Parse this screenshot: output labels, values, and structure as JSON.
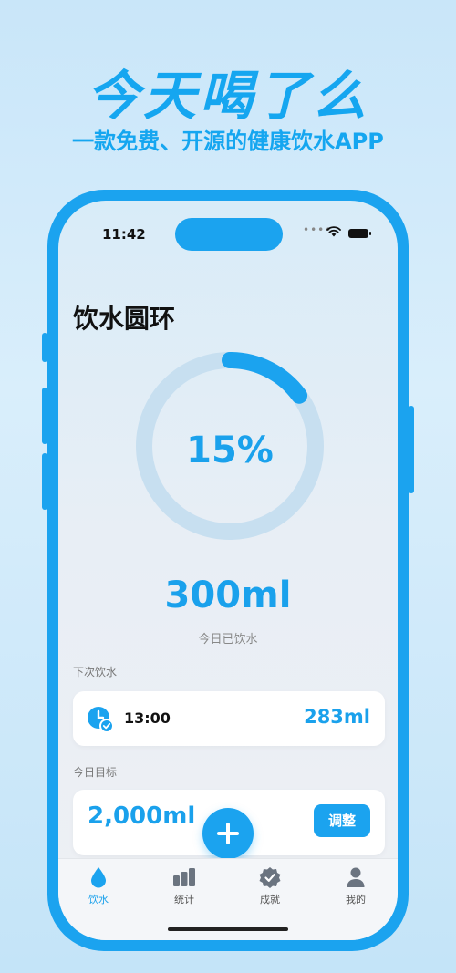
{
  "hero": {
    "title": "今天喝了么",
    "subtitle": "一款免费、开源的健康饮水APP"
  },
  "statusbar": {
    "time": "11:42",
    "signal_icon": "signal-dots-icon",
    "wifi_icon": "wifi-icon",
    "battery_icon": "battery-icon"
  },
  "page": {
    "title": "饮水圆环"
  },
  "progress": {
    "percent_text": "15%",
    "fraction": 0.15,
    "amount": "300ml",
    "amount_label": "今日已饮水"
  },
  "next_drink": {
    "section_label": "下次饮水",
    "time": "13:00",
    "amount": "283ml",
    "icon": "clock-check-icon"
  },
  "goal": {
    "section_label": "今日目标",
    "value": "2,000ml",
    "adjust_label": "调整"
  },
  "fab": {
    "icon": "plus-icon"
  },
  "tabs": [
    {
      "label": "饮水",
      "icon": "water-drop-icon",
      "active": true
    },
    {
      "label": "统计",
      "icon": "bar-chart-icon",
      "active": false
    },
    {
      "label": "成就",
      "icon": "badge-check-icon",
      "active": false
    },
    {
      "label": "我的",
      "icon": "user-icon",
      "active": false
    }
  ],
  "colors": {
    "accent": "#1ba3ef",
    "ring_track": "#c7dff0",
    "background": "#d9eefb"
  }
}
